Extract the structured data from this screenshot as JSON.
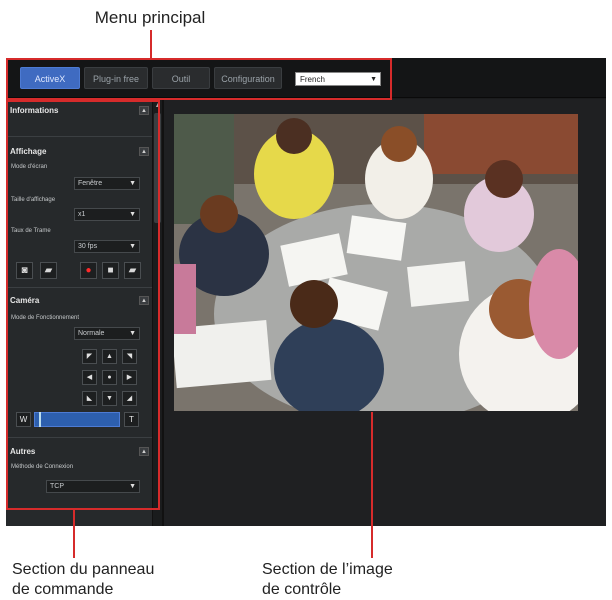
{
  "callouts": {
    "main_menu": "Menu principal",
    "control_panel_line1": "Section du panneau",
    "control_panel_line2": "de commande",
    "monitor_line1": "Section de l’image",
    "monitor_line2": "de contrôle"
  },
  "menu": {
    "buttons": [
      "ActiveX",
      "Plug-in free",
      "Outil",
      "Configuration"
    ],
    "active_index": 0,
    "language": "French"
  },
  "panel": {
    "informations": {
      "title": "Informations"
    },
    "affichage": {
      "title": "Affichage",
      "screen_mode_label": "Mode d'écran",
      "screen_mode_value": "Fenêtre",
      "display_size_label": "Taille d'affichage",
      "display_size_value": "x1",
      "frame_rate_label": "Taux de Trame",
      "frame_rate_value": "30 fps"
    },
    "camera": {
      "title": "Caméra",
      "operation_mode_label": "Mode de Fonctionnement",
      "operation_mode_value": "Normale",
      "zoom_wide": "W",
      "zoom_tele": "T"
    },
    "autres": {
      "title": "Autres",
      "connection_method_label": "Méthode de Connexion",
      "connection_method_value": "TCP"
    }
  },
  "colors": {
    "accent": "#3f6bc1",
    "callout_red": "#d62b2b"
  },
  "icons": {
    "collapse": "collapse-icon",
    "capture": "camera-capture-icon",
    "folder": "folder-icon",
    "record": "record-icon",
    "stop": "stop-icon"
  }
}
